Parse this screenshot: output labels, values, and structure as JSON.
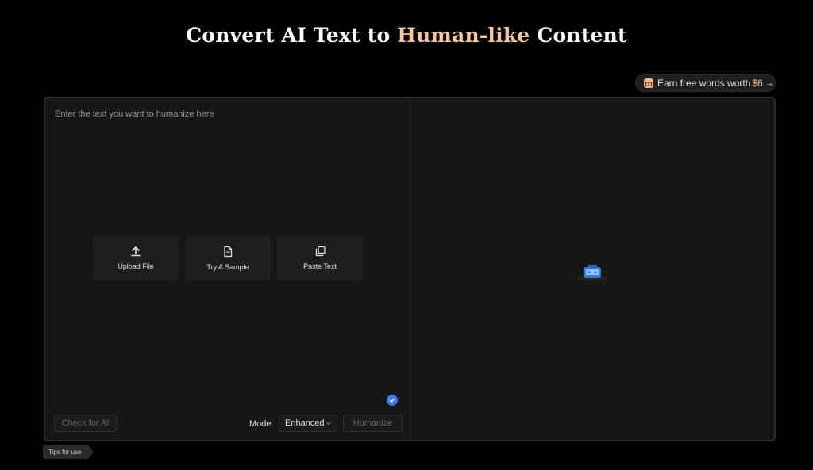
{
  "header": {
    "title_part1": "Convert AI Text to",
    "title_highlight": "Human-like",
    "title_part2": "Content"
  },
  "promo": {
    "label": "Earn free words worth",
    "amount": "$6",
    "arrow": "→"
  },
  "input": {
    "placeholder": "Enter the text you want to humanize here"
  },
  "actions": [
    {
      "label": "Upload File",
      "icon": "upload-icon"
    },
    {
      "label": "Try A Sample",
      "icon": "document-icon"
    },
    {
      "label": "Paste Text",
      "icon": "paste-icon"
    }
  ],
  "controls": {
    "check_label": "Check for AI",
    "mode_label": "Mode:",
    "mode_value": "Enhanced",
    "humanize_label": "Humanize"
  },
  "footer": {
    "tips_label": "Tips for use"
  },
  "colors": {
    "accent": "#f5c7a6",
    "badge": "#3b7de0"
  }
}
